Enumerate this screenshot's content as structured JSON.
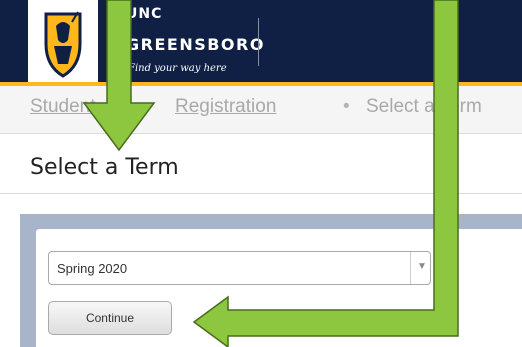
{
  "header": {
    "logo_line1": "UNC",
    "logo_line2": "GREENSBORO",
    "tagline": "Find your way here"
  },
  "breadcrumb": {
    "items": [
      {
        "label": "Student",
        "link": true
      },
      {
        "label": "Registration",
        "link": true
      },
      {
        "label": "Select a Term",
        "link": false
      }
    ],
    "separator": "•"
  },
  "page": {
    "title": "Select a Term"
  },
  "form": {
    "term_selected": "Spring 2020",
    "continue_label": "Continue"
  },
  "colors": {
    "header_navy": "#0f2044",
    "header_gold": "#ffb71b",
    "annotation_arrow": "#8dc63f",
    "content_backdrop": "#a7b4c9"
  },
  "icons": {
    "logo": "spartan-logo-icon",
    "dropdown": "chevron-down-icon"
  }
}
